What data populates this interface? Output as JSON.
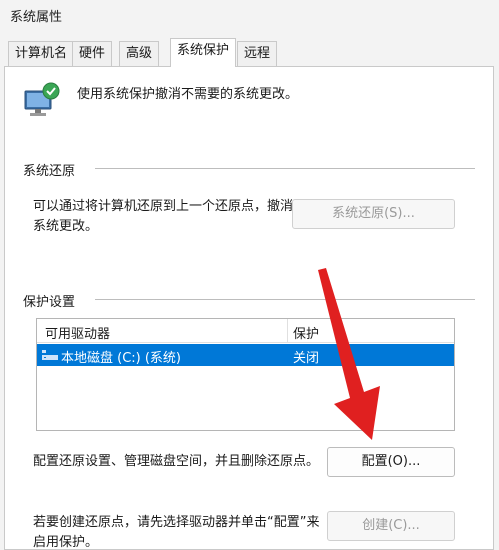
{
  "window": {
    "title": "系统属性"
  },
  "tabs": [
    {
      "label": "计算机名"
    },
    {
      "label": "硬件"
    },
    {
      "label": "高级"
    },
    {
      "label": "系统保护"
    },
    {
      "label": "远程"
    }
  ],
  "header": {
    "description": "使用系统保护撤消不需要的系统更改。"
  },
  "restore": {
    "group_title": "系统还原",
    "text": "可以通过将计算机还原到上一个还原点，撤消系统更改。",
    "text_line1": "可以通过将计算机还原到上一个还原点，撤消",
    "text_line2": "系统更改。",
    "button": "系统还原(S)..."
  },
  "protection": {
    "group_title": "保护设置",
    "columns": [
      "可用驱动器",
      "保护"
    ],
    "rows": [
      {
        "drive": "本地磁盘 (C:) (系统)",
        "status": "关闭"
      }
    ],
    "configure_text": "配置还原设置、管理磁盘空间，并且删除还原点。",
    "configure_button": "配置(O)...",
    "create_text_line1": "若要创建还原点，请先选择驱动器并单击“配置”来",
    "create_text_line2": "启用保护。",
    "create_button": "创建(C)..."
  },
  "colors": {
    "selection": "#0078d7",
    "arrow": "#e02020"
  }
}
